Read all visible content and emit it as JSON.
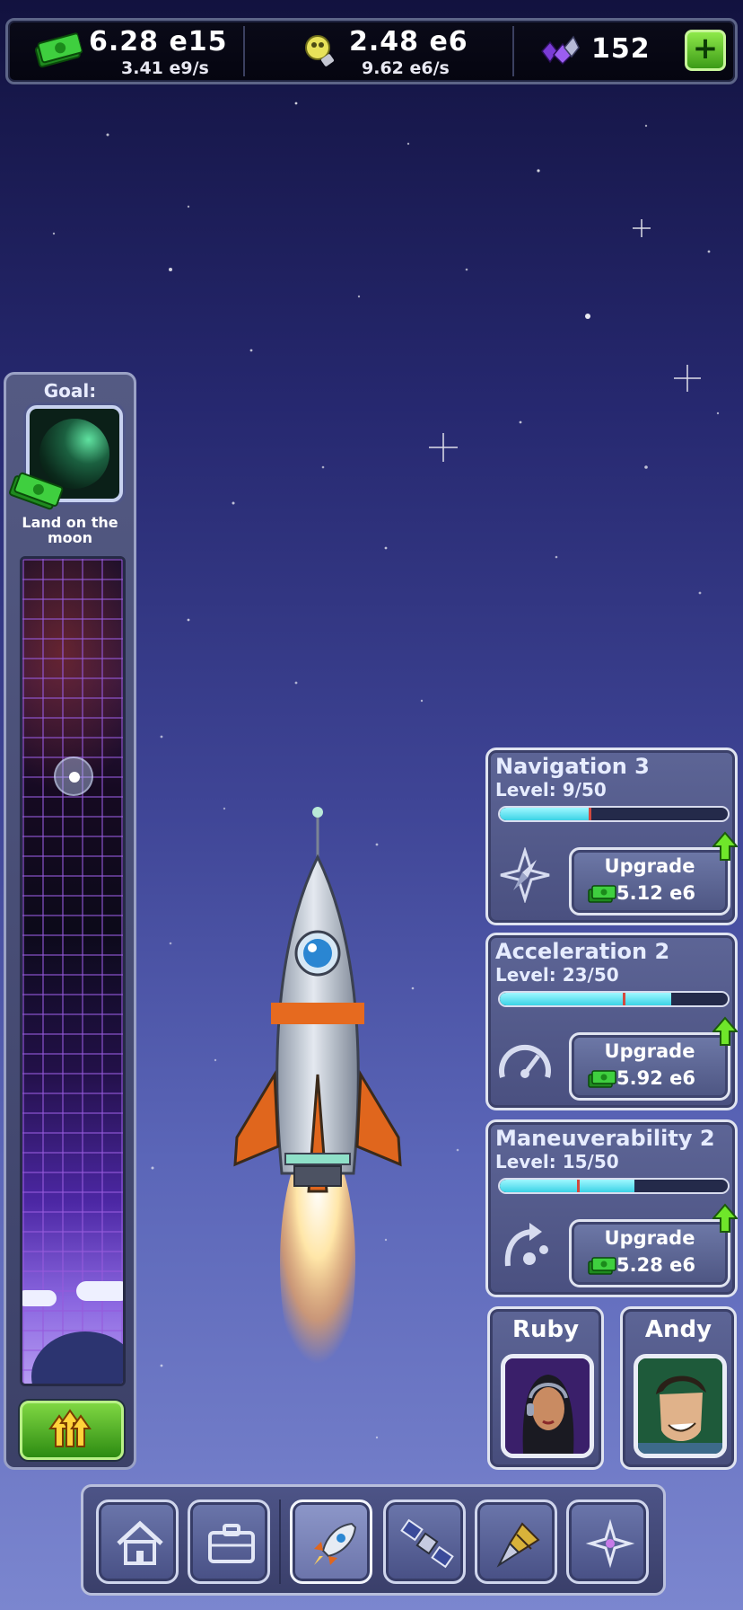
{
  "resources": {
    "cash": {
      "amount": "6.28 e15",
      "rate": "3.41 e9/s",
      "icon": "cash-icon"
    },
    "research": {
      "amount": "2.48 e6",
      "rate": "9.62 e6/s",
      "icon": "lightbulb-icon"
    },
    "gems": {
      "amount": "152",
      "icon": "gem-cluster-icon"
    },
    "add_label": "+"
  },
  "goal": {
    "title": "Goal:",
    "label": "Land on the moon",
    "progress_fraction": 0.24
  },
  "upgrades": [
    {
      "name": "Navigation 3",
      "level": "Level: 9/50",
      "progress": 0.39,
      "icon": "navigation-compass-icon",
      "button_label": "Upgrade",
      "cost": "5.12 e6"
    },
    {
      "name": "Acceleration 2",
      "level": "Level: 23/50",
      "progress": 0.75,
      "icon": "speedometer-icon",
      "button_label": "Upgrade",
      "cost": "5.92 e6"
    },
    {
      "name": "Maneuverability 2",
      "level": "Level: 15/50",
      "progress": 0.59,
      "icon": "maneuver-path-icon",
      "button_label": "Upgrade",
      "cost": "5.28 e6"
    }
  ],
  "crew": [
    {
      "name": "Ruby"
    },
    {
      "name": "Andy"
    }
  ],
  "nav": {
    "items": [
      {
        "icon": "home-icon",
        "active": false
      },
      {
        "icon": "briefcase-icon",
        "active": false
      },
      {
        "icon": "rocket-icon",
        "active": true
      },
      {
        "icon": "satellite-icon",
        "active": false
      },
      {
        "icon": "drill-icon",
        "active": false
      },
      {
        "icon": "star-compass-icon",
        "active": false
      }
    ]
  },
  "colors": {
    "accent_green": "#5cc22b",
    "bar_cyan": "#3bd3e6",
    "panel": "#545a83"
  }
}
